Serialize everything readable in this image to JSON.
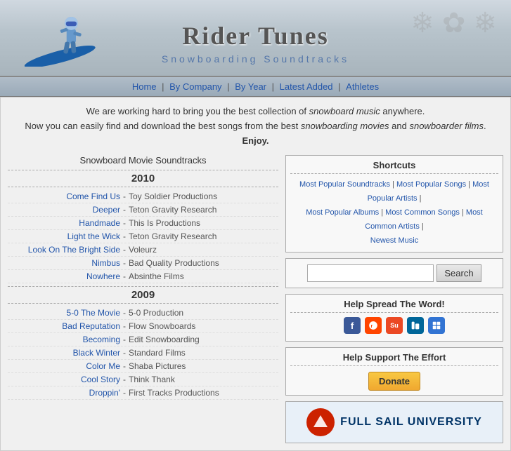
{
  "header": {
    "title": "Rider Tunes",
    "subtitle": "Snowboarding Soundtracks"
  },
  "nav": {
    "items": [
      {
        "label": "Home",
        "href": "#"
      },
      {
        "label": "By Company",
        "href": "#"
      },
      {
        "label": "By Year",
        "href": "#"
      },
      {
        "label": "Latest Added",
        "href": "#"
      },
      {
        "label": "Athletes",
        "href": "#"
      }
    ]
  },
  "intro": {
    "line1": "We are working hard to bring you the best collection of snowboard music anywhere.",
    "line2": "Now you can easily find and download the best songs from the best snowboarding movies and snowboarder films.",
    "line3": "Enjoy.",
    "italic1": "snowboard music",
    "italic2": "snowboarding movies",
    "italic3": "snowboarder films"
  },
  "soundtracks_title": "Snowboard Movie Soundtracks",
  "years": [
    {
      "year": "2010",
      "movies": [
        {
          "name": "Come Find Us",
          "company": "Toy Soldier Productions"
        },
        {
          "name": "Deeper",
          "company": "Teton Gravity Research"
        },
        {
          "name": "Handmade",
          "company": "This Is Productions"
        },
        {
          "name": "Light the Wick",
          "company": "Teton Gravity Research"
        },
        {
          "name": "Look On The Bright Side",
          "company": "Voleurz"
        },
        {
          "name": "Nimbus",
          "company": "Bad Quality Productions"
        },
        {
          "name": "Nowhere",
          "company": "Absinthe Films"
        }
      ]
    },
    {
      "year": "2009",
      "movies": [
        {
          "name": "5-0 The Movie",
          "company": "5-0 Production"
        },
        {
          "name": "Bad Reputation",
          "company": "Flow Snowboards"
        },
        {
          "name": "Becoming",
          "company": "Edit Snowboarding"
        },
        {
          "name": "Black Winter",
          "company": "Standard Films"
        },
        {
          "name": "Color Me",
          "company": "Shaba Pictures"
        },
        {
          "name": "Cool Story",
          "company": "Think Thank"
        },
        {
          "name": "Droppin'",
          "company": "First Tracks Productions"
        }
      ]
    }
  ],
  "shortcuts": {
    "title": "Shortcuts",
    "links": [
      {
        "label": "Most Popular Soundtracks",
        "href": "#"
      },
      {
        "label": "Most Popular Songs",
        "href": "#"
      },
      {
        "label": "Most Popular Artists",
        "href": "#"
      },
      {
        "label": "Most Popular Albums",
        "href": "#"
      },
      {
        "label": "Most Common Songs",
        "href": "#"
      },
      {
        "label": "Most Common Artists",
        "href": "#"
      },
      {
        "label": "Newest Music",
        "href": "#"
      }
    ]
  },
  "search": {
    "placeholder": "",
    "button_label": "Search"
  },
  "spread": {
    "title": "Help Spread The Word!",
    "icons": [
      {
        "name": "Facebook",
        "short": "f",
        "color": "#3b5998"
      },
      {
        "name": "Reddit",
        "short": "r",
        "color": "#ff4500"
      },
      {
        "name": "StumbleUpon",
        "short": "su",
        "color": "#eb4924"
      },
      {
        "name": "Digg",
        "short": "d",
        "color": "#006699"
      },
      {
        "name": "Delicious",
        "short": "del",
        "color": "#3274d3"
      }
    ]
  },
  "support": {
    "title": "Help Support The Effort",
    "donate_label": "Donate"
  },
  "ad": {
    "brand": "FULL SAIL UNIVERSITY",
    "sub": "UNIVERSITY"
  }
}
